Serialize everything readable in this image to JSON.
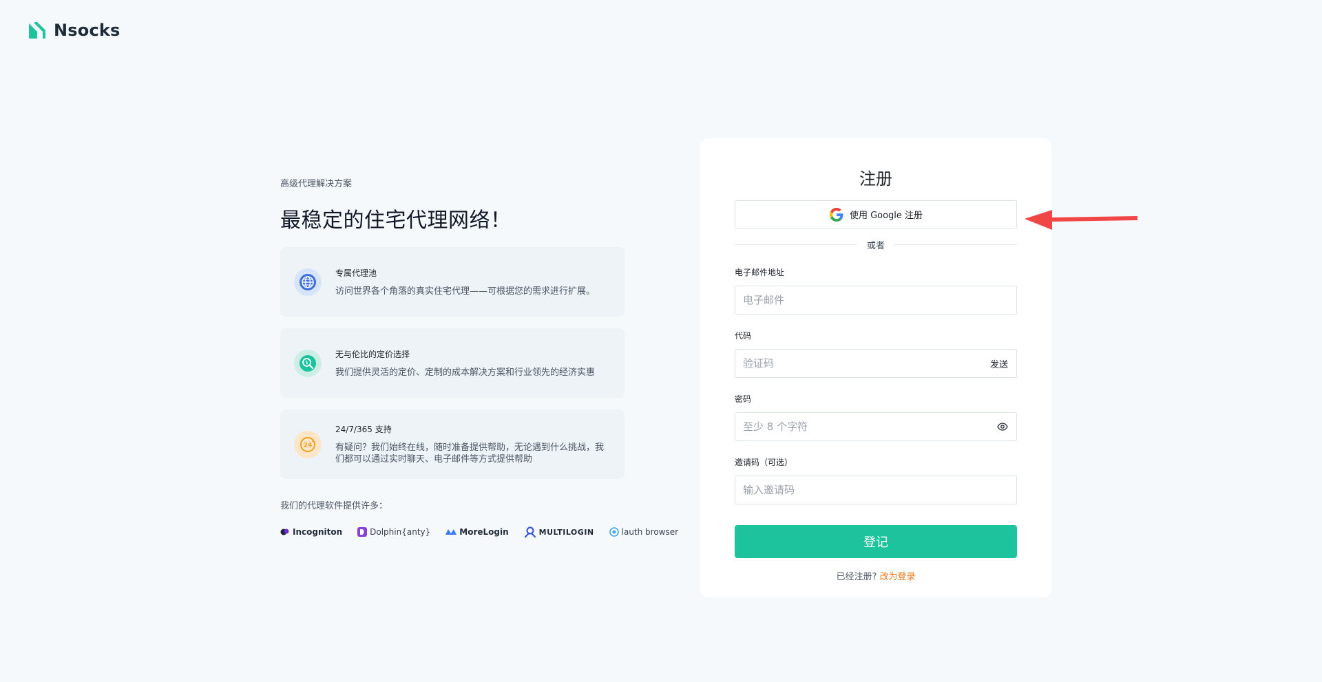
{
  "brand": {
    "name": "Nsocks",
    "accent": "#1cc39d"
  },
  "hero": {
    "tagline": "高级代理解决方案",
    "headline": "最稳定的住宅代理网络！"
  },
  "features": [
    {
      "icon": "globe-icon",
      "title": "专属代理池",
      "desc": "访问世界各个角落的真实住宅代理——可根据您的需求进行扩展。"
    },
    {
      "icon": "price-search-icon",
      "title": "无与伦比的定价选择",
      "desc": "我们提供灵活的定价、定制的成本解决方案和行业领先的经济实惠"
    },
    {
      "icon": "support-24-icon",
      "title": "24/7/365 支持",
      "desc": "有疑问？我们始终在线，随时准备提供帮助，无论遇到什么挑战，我们都可以通过实时聊天、电子邮件等方式提供帮助"
    }
  ],
  "partners": {
    "label": "我们的代理软件提供许多：",
    "items": [
      {
        "name": "Incogniton",
        "icon": "incogniton-logo-icon"
      },
      {
        "name": "Dolphin{anty}",
        "icon": "dolphin-logo-icon"
      },
      {
        "name": "MoreLogin",
        "icon": "morelogin-logo-icon"
      },
      {
        "name": "MULTILOGIN",
        "icon": "multilogin-logo-icon"
      },
      {
        "name": "lauth browser",
        "icon": "lauth-logo-icon"
      }
    ]
  },
  "form": {
    "title": "注册",
    "google_label": "使用 Google 注册",
    "divider": "或者",
    "email": {
      "label": "电子邮件地址",
      "placeholder": "电子邮件",
      "value": ""
    },
    "code": {
      "label": "代码",
      "placeholder": "验证码",
      "value": "",
      "send_label": "发送"
    },
    "password": {
      "label": "密码",
      "placeholder": "至少 8 个字符",
      "value": ""
    },
    "invite": {
      "label": "邀请码（可选）",
      "placeholder": "输入邀请码",
      "value": ""
    },
    "submit_label": "登记",
    "login_prompt": "已经注册?",
    "login_link": "改为登录"
  }
}
